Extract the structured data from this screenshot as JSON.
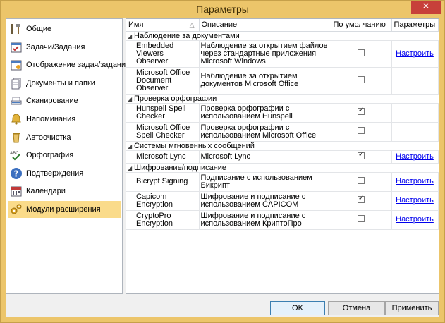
{
  "window": {
    "title": "Параметры",
    "close_glyph": "✕"
  },
  "sidebar": {
    "items": [
      {
        "label": "Общие",
        "icon": "tools-icon",
        "selected": false
      },
      {
        "label": "Задачи/Задания",
        "icon": "tasks-icon",
        "selected": false
      },
      {
        "label": "Отображение задач/заданий",
        "icon": "task-view-icon",
        "selected": false
      },
      {
        "label": "Документы и папки",
        "icon": "documents-icon",
        "selected": false
      },
      {
        "label": "Сканирование",
        "icon": "scanner-icon",
        "selected": false
      },
      {
        "label": "Напоминания",
        "icon": "bell-icon",
        "selected": false
      },
      {
        "label": "Автоочистка",
        "icon": "cleanup-icon",
        "selected": false
      },
      {
        "label": "Орфография",
        "icon": "spelling-icon",
        "selected": false
      },
      {
        "label": "Подтверждения",
        "icon": "question-icon",
        "selected": false
      },
      {
        "label": "Календари",
        "icon": "calendar-icon",
        "selected": false
      },
      {
        "label": "Модули расширения",
        "icon": "plugins-icon",
        "selected": true
      }
    ]
  },
  "table": {
    "columns": {
      "name": "Имя",
      "description": "Описание",
      "default": "По умолчанию",
      "params": "Параметры"
    },
    "groups": [
      {
        "title": "Наблюдение за документами",
        "rows": [
          {
            "name": "Embedded Viewers Observer",
            "description": "Наблюдение за открытием файлов через стандартные приложения Microsoft Windows",
            "checked": false,
            "params": "Настроить"
          },
          {
            "name": "Microsoft Office Document Observer",
            "description": "Наблюдение за открытием документов Microsoft Office",
            "checked": false,
            "params": ""
          }
        ]
      },
      {
        "title": "Проверка орфографии",
        "rows": [
          {
            "name": "Hunspell Spell Checker",
            "description": "Проверка орфографии с использованием Hunspell",
            "checked": true,
            "params": ""
          },
          {
            "name": "Microsoft Office Spell Checker",
            "description": "Проверка орфографии с использованием Microsoft Office",
            "checked": false,
            "params": ""
          }
        ]
      },
      {
        "title": "Системы мгновенных сообщений",
        "rows": [
          {
            "name": "Microsoft Lync",
            "description": "Microsoft Lync",
            "checked": true,
            "params": "Настроить"
          }
        ]
      },
      {
        "title": "Шифрование/подписание",
        "rows": [
          {
            "name": "Bicrypt Signing",
            "description": "Подписание с использованием Бикрипт",
            "checked": false,
            "params": "Настроить"
          },
          {
            "name": "Capicom Encryption",
            "description": "Шифрование и подписание с использованием CAPICOM",
            "checked": true,
            "params": "Настроить"
          },
          {
            "name": "CryptoPro Encryption",
            "description": "Шифрование и подписание с использованием КриптоПро",
            "checked": false,
            "params": "Настроить"
          }
        ]
      }
    ]
  },
  "footer": {
    "ok": "OK",
    "cancel": "Отмена",
    "apply": "Применить"
  }
}
